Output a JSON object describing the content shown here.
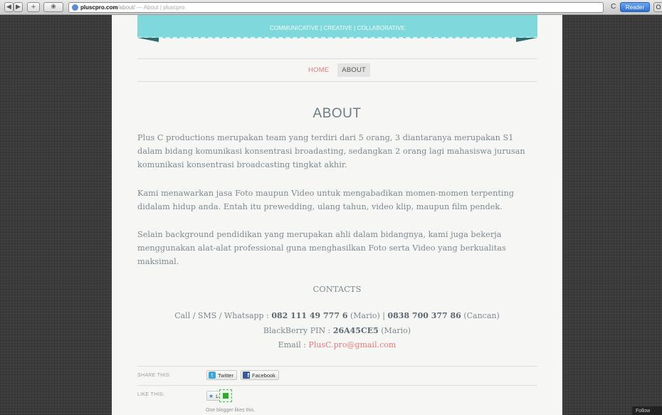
{
  "browser": {
    "back_glyph": "◀",
    "forward_glyph": "▶",
    "add_glyph": "+",
    "url_host": "pluscpro.com",
    "url_path": "/about/",
    "page_title": "— About | pluscpro",
    "reload_glyph": "C",
    "reader_label": "Reader",
    "extra_glyph": "O"
  },
  "header": {
    "tagline": "COMMUNICATIVE | CREATIVE | COLLABORATIVE"
  },
  "nav": {
    "home": "HOME",
    "about": "ABOUT"
  },
  "about": {
    "title": "ABOUT",
    "paragraph_1": "Plus C productions merupakan team yang terdiri dari 5 orang, 3 diantaranya merupakan S1 dalam bidang komunikasi konsentrasi broadasting, sedangkan 2 orang lagi mahasiswa jurusan komunikasi konsentrasi broadcasting tingkat akhir.",
    "paragraph_2": "Kami menawarkan jasa Foto maupun Video untuk mengabadikan momen-momen terpenting didalam hidup anda. Entah itu prewedding, ulang tahun, video klip, maupun film pendek.",
    "paragraph_3": "Selain background pendidikan yang merupakan ahli dalam bidangnya, kami juga bekerja menggunakan alat-alat professional guna menghasilkan Foto serta Video yang berkualitas maksimal."
  },
  "contacts": {
    "heading": "CONTACTS",
    "call_label": "Call / SMS / Whatsapp : ",
    "phone_1": "082 111 49 777 6",
    "phone_1_name": " (Mario) | ",
    "phone_2": "0838 700 377 86",
    "phone_2_name": " (Cancan)",
    "bbm_label": "BlackBerry PIN : ",
    "bbm_pin": "26A45CE5",
    "bbm_name": " (Mario)",
    "email_label": "Email : ",
    "email": "PlusC.pro@gmail.com"
  },
  "share": {
    "label": "SHARE THIS:",
    "twitter": "Twitter",
    "facebook": "Facebook"
  },
  "like": {
    "label": "LIKE THIS:",
    "button": "Like",
    "count_text": "One blogger likes this."
  },
  "footer": {
    "following": "Follow"
  },
  "colors": {
    "ribbon": "#7fd9dc",
    "accent_pink": "#e8787d",
    "text": "#7d8a8f"
  }
}
